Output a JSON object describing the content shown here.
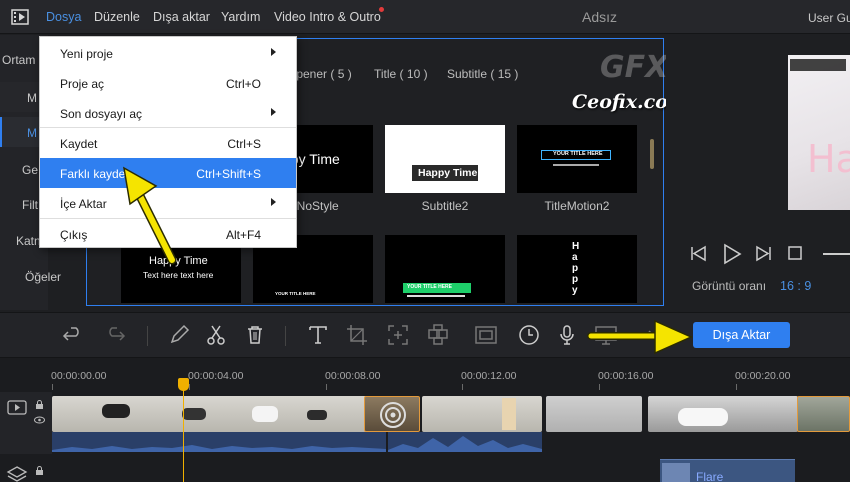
{
  "menubar": {
    "items": [
      "Dosya",
      "Düzenle",
      "Dışa aktar",
      "Yardım",
      "Video Intro & Outro"
    ],
    "title": "Adsız",
    "user": "User Gu"
  },
  "sidebar": {
    "items": [
      "Ortam (",
      "M",
      "M",
      "Ge",
      "Filt",
      "Katn",
      "Öğeler"
    ]
  },
  "media": {
    "tabs": [
      "Opener ( 5 )",
      "Title ( 10 )",
      "Subtitle ( 15 )"
    ],
    "thumbs": [
      {
        "text": "ppy Time",
        "label": "ctNoStyle"
      },
      {
        "text": "Happy Time",
        "label": "Subtitle2"
      },
      {
        "text": "YOUR TITLE HERE",
        "label": "TitleMotion2"
      },
      {
        "text": "Happy Time",
        "subtext": "Text here text here"
      },
      {
        "text": "YOUR TITLE HERE"
      },
      {
        "text": "YOUR TITLE HERE"
      },
      {
        "text": "Happy"
      }
    ]
  },
  "preview": {
    "ratio_label": "Görüntü oranı",
    "ratio_value": "16 : 9",
    "preview_text": "Ha"
  },
  "dropdown": {
    "items": [
      {
        "label": "Yeni proje",
        "shortcut": "",
        "submenu": true
      },
      {
        "label": "Proje aç",
        "shortcut": "Ctrl+O",
        "submenu": false
      },
      {
        "label": "Son dosyayı aç",
        "shortcut": "",
        "submenu": true
      },
      {
        "label": "Kaydet",
        "shortcut": "Ctrl+S",
        "submenu": false
      },
      {
        "label": "Farklı kaydet",
        "shortcut": "Ctrl+Shift+S",
        "submenu": false
      },
      {
        "label": "İçe Aktar",
        "shortcut": "",
        "submenu": true
      },
      {
        "label": "Çıkış",
        "shortcut": "Alt+F4",
        "submenu": false
      }
    ]
  },
  "toolbar": {
    "export_label": "Dışa Aktar"
  },
  "timeline": {
    "ruler": [
      "00:00:00.00",
      "00:00:04.00",
      "00:00:08.00",
      "00:00:12.00",
      "00:00:16.00",
      "00:00:20.00"
    ],
    "flare_label": "Flare"
  },
  "watermark": {
    "logo": "GFX",
    "site": "Ceofix.com"
  },
  "colors": {
    "accent": "#2f7ff0",
    "annotation_arrow": "#f5e400",
    "playhead": "#f0b000"
  }
}
